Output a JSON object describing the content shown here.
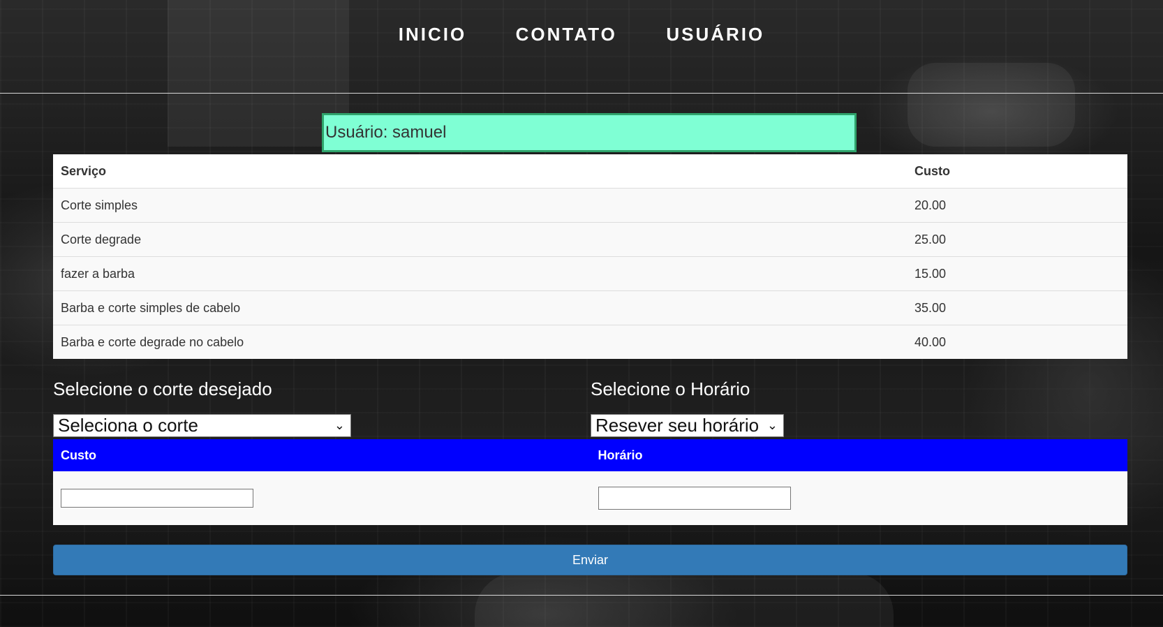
{
  "nav": {
    "items": [
      "INICIO",
      "CONTATO",
      "USUÁRIO"
    ]
  },
  "user_banner": "Usuário: samuel",
  "services_table": {
    "headers": [
      "Serviço",
      "Custo"
    ],
    "rows": [
      [
        "Corte simples",
        "20.00"
      ],
      [
        "Corte degrade",
        "25.00"
      ],
      [
        "fazer a barba",
        "15.00"
      ],
      [
        "Barba e corte simples de cabelo",
        "35.00"
      ],
      [
        "Barba e corte degrade no cabelo",
        "40.00"
      ]
    ]
  },
  "selection": {
    "cut_heading": "Selecione o corte desejado",
    "cut_select_value": "Seleciona o corte",
    "time_heading": "Selecione o Horário",
    "time_select_value": "Resever seu horário"
  },
  "summary_table": {
    "headers": [
      "Custo",
      "Horário"
    ],
    "cost_value": "",
    "time_value": ""
  },
  "submit_label": "Enviar",
  "colors": {
    "banner_bg": "#7fffd4",
    "summary_header_bg": "#0000ff",
    "submit_bg": "#337ab7"
  }
}
